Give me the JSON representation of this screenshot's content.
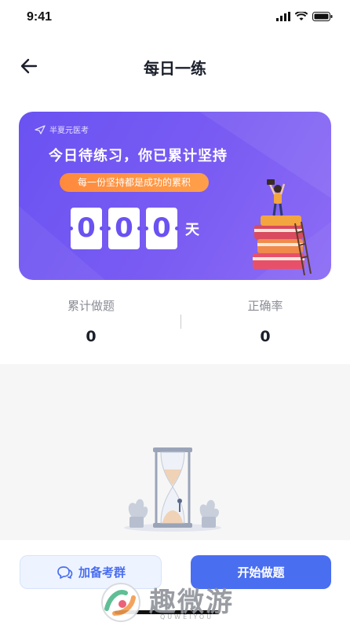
{
  "status_bar": {
    "time": "9:41"
  },
  "nav": {
    "title": "每日一练"
  },
  "banner": {
    "brand": "半夏元医考",
    "headline": "今日待练习，你已累计坚持",
    "motto": "每一份坚持都是成功的累积",
    "streak_digits": [
      "0",
      "0",
      "0"
    ],
    "unit": "天"
  },
  "stats": {
    "total_label": "累计做题",
    "total_value": "0",
    "accuracy_label": "正确率",
    "accuracy_value": "0"
  },
  "actions": {
    "join_group": "加备考群",
    "start": "开始做题"
  },
  "watermark": {
    "text": "趣微游",
    "sub": "QUWEIYOU"
  },
  "colors": {
    "banner": "#6a52f2",
    "motto": "#ff8a3d",
    "primary": "#4a6ef0"
  }
}
